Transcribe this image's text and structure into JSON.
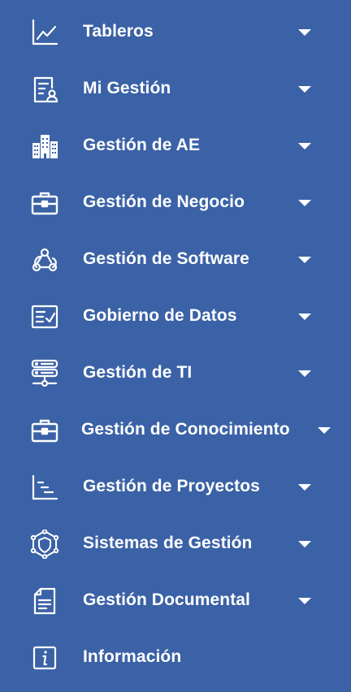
{
  "menu": {
    "items": [
      {
        "label": "Tableros",
        "icon": "line-chart-icon",
        "has_submenu": true
      },
      {
        "label": "Mi Gestión",
        "icon": "document-user-icon",
        "has_submenu": true
      },
      {
        "label": "Gestión de AE",
        "icon": "buildings-icon",
        "has_submenu": true
      },
      {
        "label": "Gestión de Negocio",
        "icon": "briefcase-icon",
        "has_submenu": true
      },
      {
        "label": "Gestión de Software",
        "icon": "webhook-icon",
        "has_submenu": true
      },
      {
        "label": "Gobierno de Datos",
        "icon": "checklist-icon",
        "has_submenu": true
      },
      {
        "label": "Gestión de TI",
        "icon": "server-icon",
        "has_submenu": true
      },
      {
        "label": "Gestión de Conocimiento",
        "icon": "briefcase-icon",
        "has_submenu": true
      },
      {
        "label": "Gestión de Proyectos",
        "icon": "gantt-chart-icon",
        "has_submenu": true
      },
      {
        "label": "Sistemas de Gestión",
        "icon": "shield-network-icon",
        "has_submenu": true
      },
      {
        "label": "Gestión Documental",
        "icon": "document-icon",
        "has_submenu": true
      },
      {
        "label": "Información",
        "icon": "info-icon",
        "has_submenu": false
      }
    ]
  },
  "colors": {
    "background": "#3b62a6",
    "foreground": "#ffffff"
  }
}
